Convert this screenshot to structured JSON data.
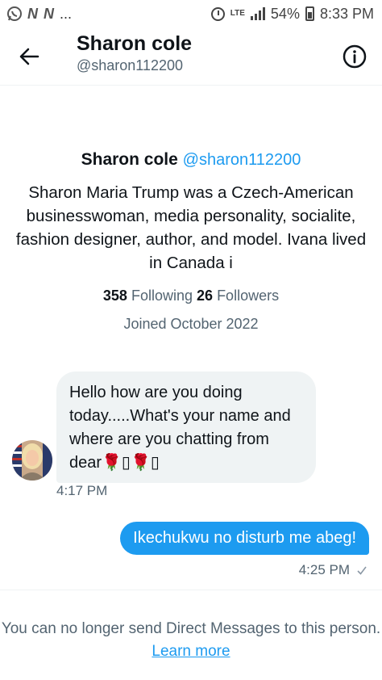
{
  "status_bar": {
    "left_letters": "N N",
    "ellipsis": "...",
    "network": "LTE",
    "battery": "54%",
    "time": "8:33 PM",
    "icons": [
      "whatsapp-icon",
      "alarm-icon",
      "signal-icon",
      "battery-icon"
    ]
  },
  "header": {
    "back_icon": "arrow-left-icon",
    "title": "Sharon cole",
    "handle": "@sharon112200",
    "info_icon": "info-icon"
  },
  "profile": {
    "name": "Sharon cole",
    "handle": "@sharon112200",
    "bio": "Sharon Maria Trump was a Czech-American businesswoman, media personality, socialite, fashion designer, author, and model. Ivana lived in Canada i",
    "following_count": "358",
    "following_label": "Following",
    "followers_count": "26",
    "followers_label": "Followers",
    "joined": "Joined October 2022"
  },
  "messages": [
    {
      "direction": "incoming",
      "text": "Hello how are you doing today.....What's your name and where are you chatting from dear🌹▯🌹▯",
      "time": "4:17 PM"
    },
    {
      "direction": "outgoing",
      "text": "Ikechukwu no disturb me abeg!",
      "time": "4:25 PM",
      "status_icon": "checkmark-icon"
    }
  ],
  "footer": {
    "text": "You can no longer send Direct Messages to this person.",
    "link": "Learn more"
  },
  "colors": {
    "accent": "#1d9bf0",
    "secondary_text": "#536471",
    "bubble_incoming": "#eff3f4"
  }
}
